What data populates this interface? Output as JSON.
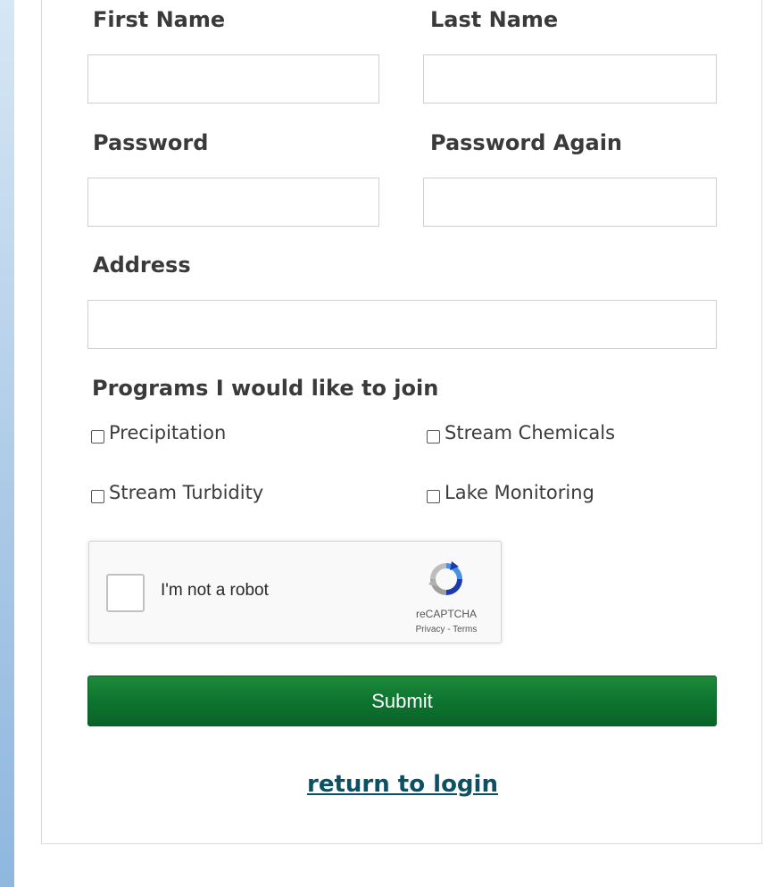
{
  "form": {
    "first_name": {
      "label": "First Name",
      "value": "",
      "placeholder": ""
    },
    "last_name": {
      "label": "Last Name",
      "value": "",
      "placeholder": ""
    },
    "password": {
      "label": "Password",
      "value": "",
      "placeholder": ""
    },
    "password_again": {
      "label": "Password Again",
      "value": "",
      "placeholder": ""
    },
    "address": {
      "label": "Address",
      "value": "",
      "placeholder": ""
    },
    "programs": {
      "heading": "Programs I would like to join",
      "options": [
        {
          "label": "Precipitation",
          "checked": false
        },
        {
          "label": "Stream Chemicals",
          "checked": false
        },
        {
          "label": "Stream Turbidity",
          "checked": false
        },
        {
          "label": "Lake Monitoring",
          "checked": false
        }
      ]
    },
    "captcha": {
      "text": "I'm not a robot",
      "brand": "reCAPTCHA",
      "links": "Privacy - Terms",
      "checked": false,
      "icon": "recaptcha-logo-icon"
    },
    "submit_label": "Submit",
    "return_link": "return to login"
  },
  "colors": {
    "submit_green": "#0e7430",
    "link_teal": "#0d4f63",
    "label_text": "#3a3a3a"
  }
}
